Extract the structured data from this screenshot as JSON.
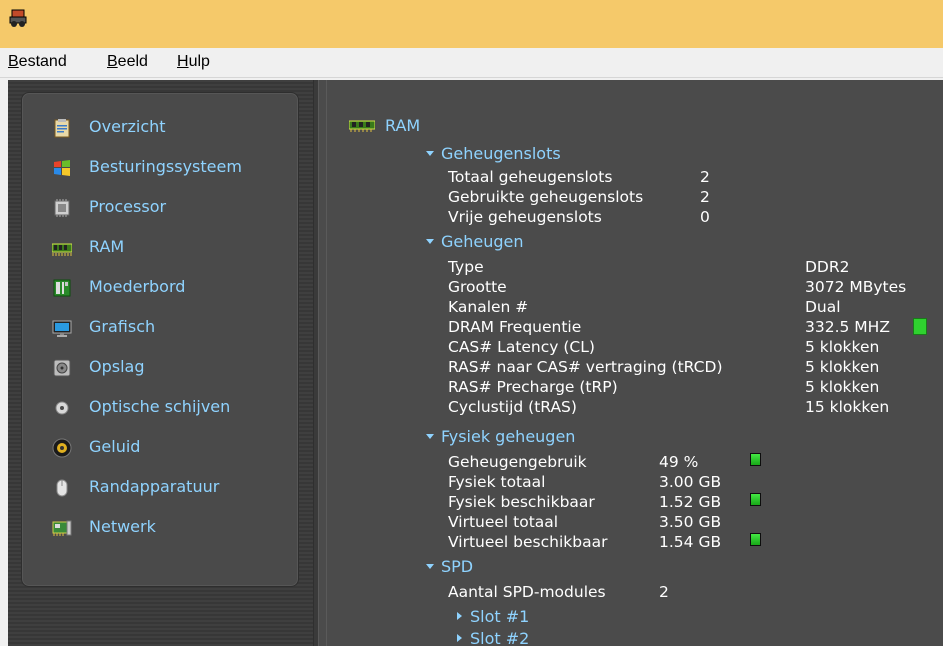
{
  "menu": {
    "items": [
      {
        "acc": "B",
        "rest": "estand"
      },
      {
        "acc": "B",
        "rest": "eeld"
      },
      {
        "acc": "H",
        "rest": "ulp"
      }
    ]
  },
  "sidebar": {
    "items": [
      {
        "label": "Overzicht",
        "icon": "clipboard-icon"
      },
      {
        "label": "Besturingssysteem",
        "icon": "windows-logo-icon"
      },
      {
        "label": "Processor",
        "icon": "cpu-chip-icon"
      },
      {
        "label": "RAM",
        "icon": "ram-module-icon"
      },
      {
        "label": "Moederbord",
        "icon": "motherboard-icon"
      },
      {
        "label": "Grafisch",
        "icon": "monitor-icon"
      },
      {
        "label": "Opslag",
        "icon": "hard-drive-icon"
      },
      {
        "label": "Optische schijven",
        "icon": "optical-disc-icon"
      },
      {
        "label": "Geluid",
        "icon": "speaker-icon"
      },
      {
        "label": "Randapparatuur",
        "icon": "mouse-icon"
      },
      {
        "label": "Netwerk",
        "icon": "network-card-icon"
      }
    ]
  },
  "content": {
    "title": "RAM",
    "slots": {
      "heading": "Geheugenslots",
      "rows": [
        {
          "label": "Totaal geheugenslots",
          "value": "2"
        },
        {
          "label": "Gebruikte geheugenslots",
          "value": "2"
        },
        {
          "label": "Vrije geheugenslots",
          "value": "0"
        }
      ]
    },
    "memory": {
      "heading": "Geheugen",
      "rows": [
        {
          "label": "Type",
          "value": "DDR2"
        },
        {
          "label": "Grootte",
          "value": "3072 MBytes"
        },
        {
          "label": "Kanalen #",
          "value": "Dual"
        },
        {
          "label": "DRAM Frequentie",
          "value": "332.5 MHZ"
        },
        {
          "label": "CAS# Latency (CL)",
          "value": "5 klokken"
        },
        {
          "label": "RAS# naar CAS# vertraging (tRCD)",
          "value": "5 klokken"
        },
        {
          "label": "RAS# Precharge (tRP)",
          "value": "5 klokken"
        },
        {
          "label": "Cyclustijd (tRAS)",
          "value": "15 klokken"
        }
      ]
    },
    "physical": {
      "heading": "Fysiek geheugen",
      "rows": [
        {
          "label": "Geheugengebruik",
          "value": "49 %"
        },
        {
          "label": "Fysiek totaal",
          "value": "3.00 GB"
        },
        {
          "label": "Fysiek beschikbaar",
          "value": "1.52 GB"
        },
        {
          "label": "Virtueel totaal",
          "value": "3.50 GB"
        },
        {
          "label": "Virtueel beschikbaar",
          "value": "1.54 GB"
        }
      ]
    },
    "spd": {
      "heading": "SPD",
      "count_label": "Aantal SPD-modules",
      "count_value": "2",
      "slots": [
        "Slot #1",
        "Slot #2"
      ]
    }
  },
  "colors": {
    "accent": "#8fd3ff",
    "titlebar": "#f5c96a",
    "panel": "#4b4b4b",
    "gauge": "#2fd12f"
  }
}
